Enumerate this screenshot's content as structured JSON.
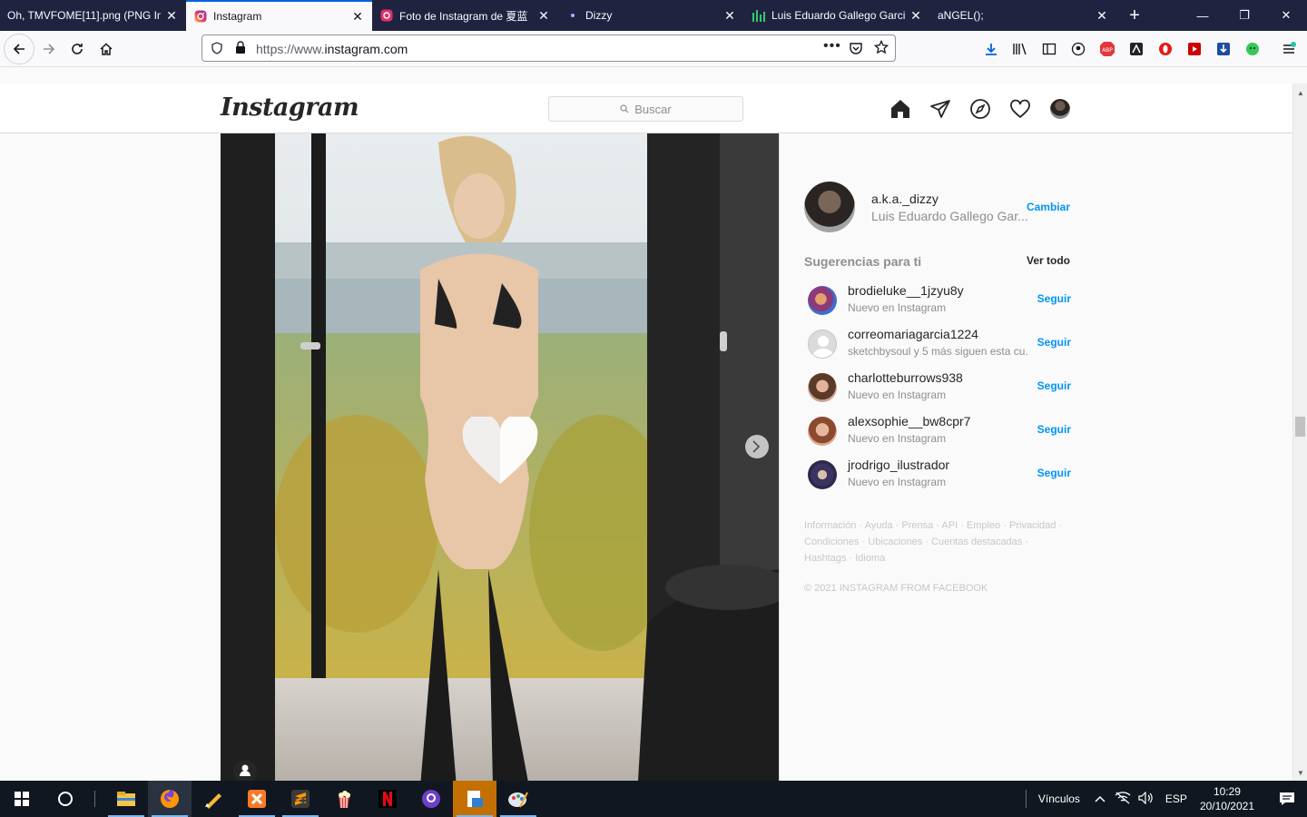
{
  "browser": {
    "tabs": [
      {
        "title": "Oh, TMVFOME[11].png (PNG Im",
        "active": false,
        "icon": "image-file-icon"
      },
      {
        "title": "Instagram",
        "active": true,
        "icon": "instagram-icon"
      },
      {
        "title": "Foto de Instagram de 夏蓝",
        "active": false,
        "icon": "instagram-icon"
      },
      {
        "title": "Dizzy",
        "active": false,
        "icon": "dot-icon"
      },
      {
        "title": "Luis Eduardo Gallego Garci",
        "active": false,
        "icon": "chart-icon"
      },
      {
        "title": "aNGEL();",
        "active": false,
        "icon": "none"
      }
    ],
    "url": "https://www.instagram.com",
    "url_host": "instagram.com",
    "url_prefix": "https://www."
  },
  "instagram": {
    "logo": "Instagram",
    "search_placeholder": "Buscar",
    "profile": {
      "username": "a.k.a._dizzy",
      "fullname": "Luis Eduardo Gallego Gar...",
      "switch_label": "Cambiar"
    },
    "suggestions_title": "Sugerencias para ti",
    "see_all": "Ver todo",
    "suggestions": [
      {
        "username": "brodieluke__1jzyu8y",
        "sub": "Nuevo en Instagram",
        "follow": "Seguir"
      },
      {
        "username": "correomariagarcia1224",
        "sub": "sketchbysoul y 5 más siguen esta cu...",
        "follow": "Seguir"
      },
      {
        "username": "charlotteburrows938",
        "sub": "Nuevo en Instagram",
        "follow": "Seguir"
      },
      {
        "username": "alexsophie__bw8cpr7",
        "sub": "Nuevo en Instagram",
        "follow": "Seguir"
      },
      {
        "username": "jrodrigo_ilustrador",
        "sub": "Nuevo en Instagram",
        "follow": "Seguir"
      }
    ],
    "footer_line1": "Información · Ayuda · Prensa · API · Empleo · Privacidad ·",
    "footer_line2": "Condiciones · Ubicaciones · Cuentas destacadas ·",
    "footer_line3": "Hashtags · Idioma",
    "copyright": "© 2021 INSTAGRAM FROM FACEBOOK"
  },
  "taskbar": {
    "vinculos": "Vínculos",
    "lang": "ESP",
    "time": "10:29",
    "date": "20/10/2021"
  },
  "colors": {
    "accent": "#0095f6",
    "tabbar": "#202340",
    "taskbar": "#101720"
  }
}
